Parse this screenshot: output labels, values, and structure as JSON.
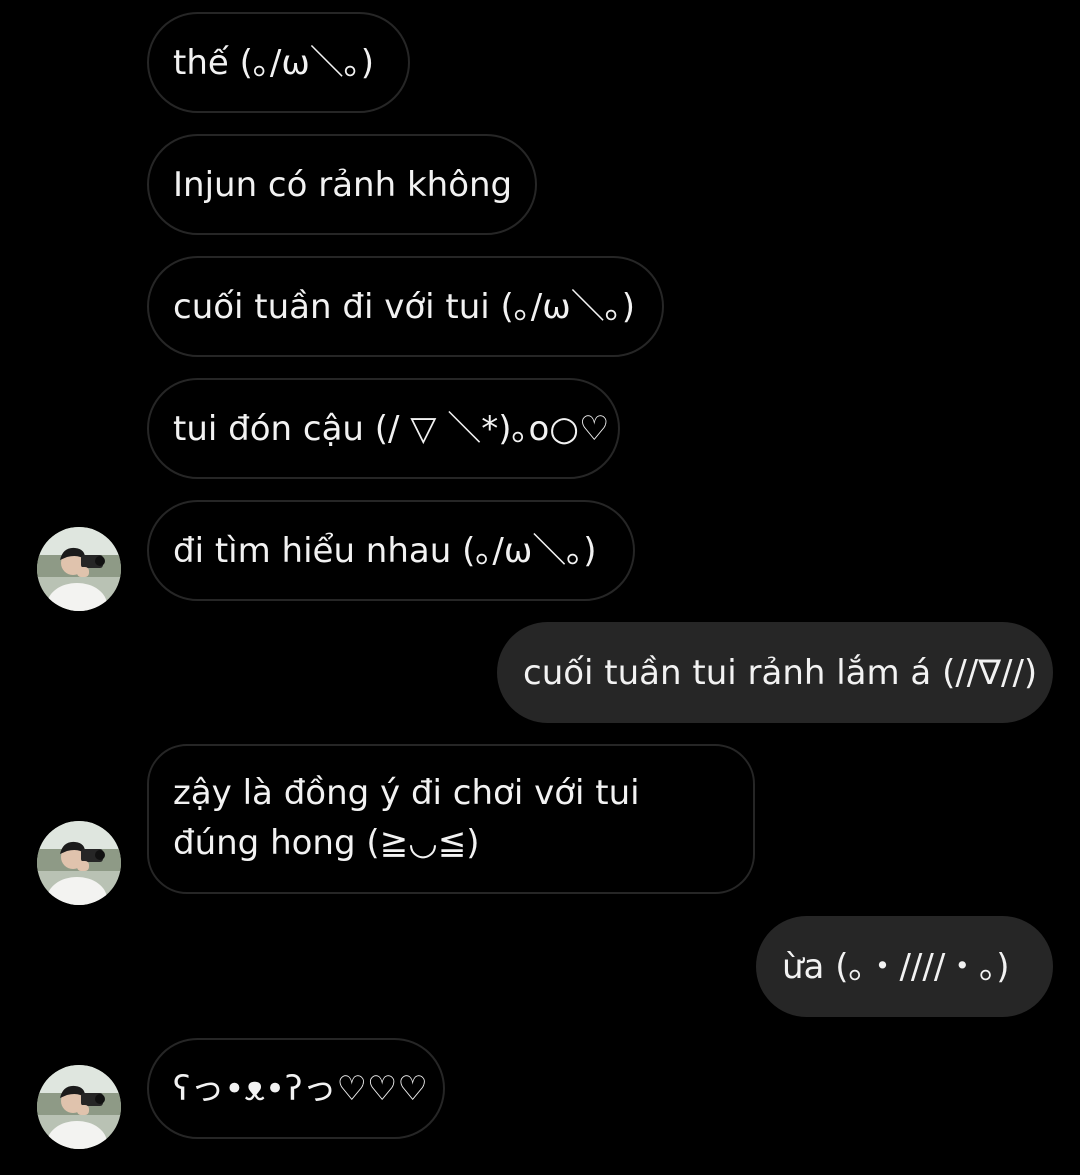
{
  "conversation": {
    "messages": [
      {
        "side": "in",
        "text": "thế (｡/ω＼｡)"
      },
      {
        "side": "in",
        "text": "Injun có rảnh không"
      },
      {
        "side": "in",
        "text": "cuối tuần đi với tui (｡/ω＼｡)"
      },
      {
        "side": "in",
        "text": "tui đón cậu (/ ▽ ＼*)｡o○♡"
      },
      {
        "side": "in",
        "text": "đi tìm hiểu nhau (｡/ω＼｡)"
      },
      {
        "side": "out",
        "text": "cuối tuần tui rảnh lắm á (//∇//)"
      },
      {
        "side": "in",
        "text": "zậy là đồng ý đi chơi với tui đúng hong (≧◡≦)"
      },
      {
        "side": "out",
        "text": "ừa (｡・////・｡)"
      },
      {
        "side": "in",
        "text": "ʕっ•ᴥ•ʔっ♡♡♡"
      }
    ],
    "avatar_icon": "person-with-camera-avatar",
    "colors": {
      "background": "#000000",
      "incoming_border": "#262626",
      "outgoing_fill": "#262626",
      "text": "#f2f2f2"
    }
  }
}
